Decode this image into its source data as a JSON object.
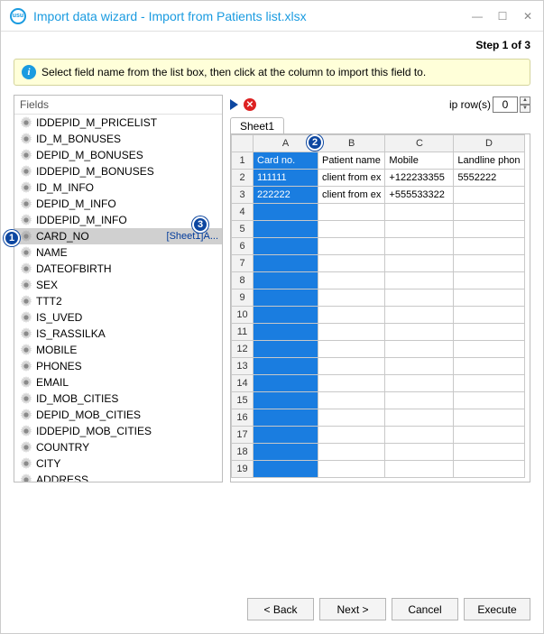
{
  "window": {
    "title": "Import data wizard - Import from Patients list.xlsx",
    "step_indicator": "Step 1 of 3",
    "instruction": "Select field name from the list box, then click at the column to import this field to."
  },
  "fields_panel": {
    "header": "Fields",
    "items": [
      {
        "label": "IDDEPID_M_PRICELIST",
        "mapping": ""
      },
      {
        "label": "ID_M_BONUSES",
        "mapping": ""
      },
      {
        "label": "DEPID_M_BONUSES",
        "mapping": ""
      },
      {
        "label": "IDDEPID_M_BONUSES",
        "mapping": ""
      },
      {
        "label": "ID_M_INFO",
        "mapping": ""
      },
      {
        "label": "DEPID_M_INFO",
        "mapping": ""
      },
      {
        "label": "IDDEPID_M_INFO",
        "mapping": ""
      },
      {
        "label": "CARD_NO",
        "mapping": "[Sheet1]A...",
        "selected": true
      },
      {
        "label": "NAME",
        "mapping": ""
      },
      {
        "label": "DATEOFBIRTH",
        "mapping": ""
      },
      {
        "label": "SEX",
        "mapping": ""
      },
      {
        "label": "TTT2",
        "mapping": ""
      },
      {
        "label": "IS_UVED",
        "mapping": ""
      },
      {
        "label": "IS_RASSILKA",
        "mapping": ""
      },
      {
        "label": "MOBILE",
        "mapping": ""
      },
      {
        "label": "PHONES",
        "mapping": ""
      },
      {
        "label": "EMAIL",
        "mapping": ""
      },
      {
        "label": "ID_MOB_CITIES",
        "mapping": ""
      },
      {
        "label": "DEPID_MOB_CITIES",
        "mapping": ""
      },
      {
        "label": "IDDEPID_MOB_CITIES",
        "mapping": ""
      },
      {
        "label": "COUNTRY",
        "mapping": ""
      },
      {
        "label": "CITY",
        "mapping": ""
      },
      {
        "label": "ADDRESS",
        "mapping": ""
      }
    ]
  },
  "skip_rows": {
    "label": "ip row(s)",
    "value": "0"
  },
  "sheet": {
    "tab": "Sheet1",
    "columns": [
      "A",
      "B",
      "C",
      "D"
    ],
    "row_count": 19,
    "selected_col": 0,
    "rows": [
      [
        "Card no.",
        "Patient name",
        "Mobile",
        "Landline phon"
      ],
      [
        "111111",
        "client from ex",
        "+122233355",
        "5552222"
      ],
      [
        "222222",
        "client from ex",
        "+555533322",
        ""
      ]
    ]
  },
  "markers": {
    "m1": "1",
    "m2": "2",
    "m3": "3"
  },
  "buttons": {
    "back": "< Back",
    "next": "Next >",
    "cancel": "Cancel",
    "execute": "Execute"
  }
}
